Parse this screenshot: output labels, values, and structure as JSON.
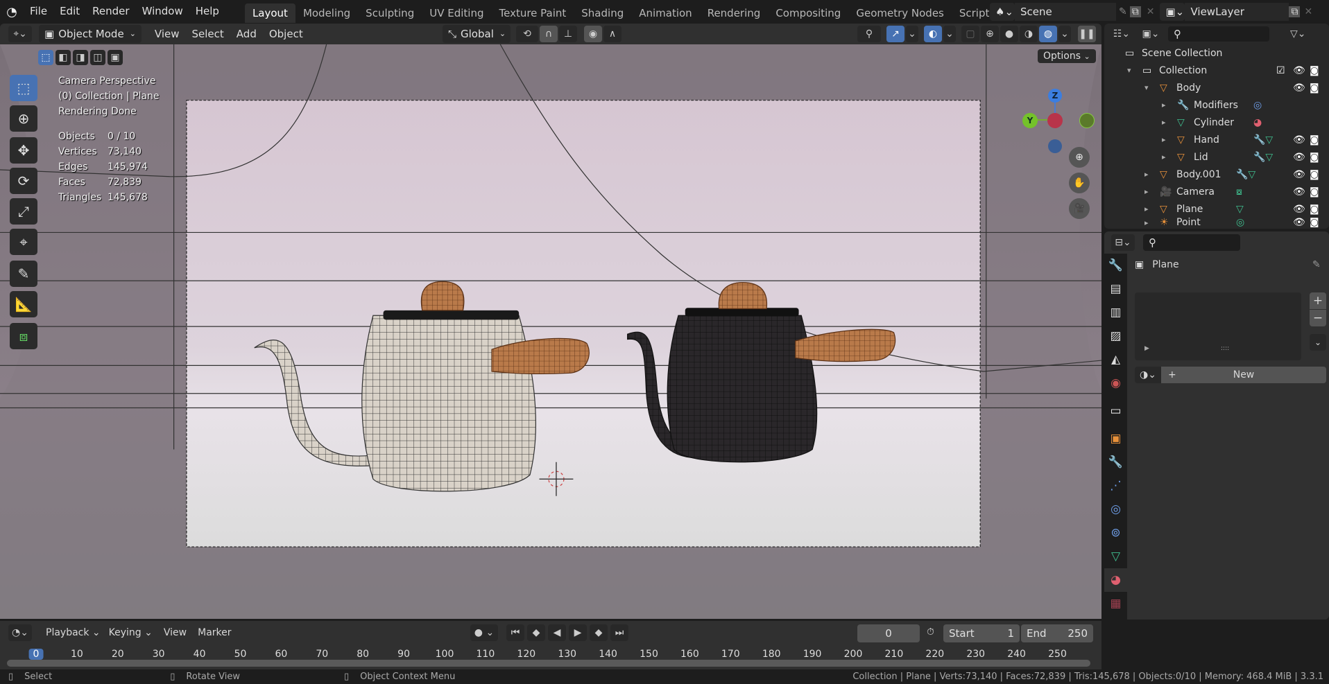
{
  "topbar": {
    "menus": [
      "File",
      "Edit",
      "Render",
      "Window",
      "Help"
    ],
    "workspaces": [
      "Layout",
      "Modeling",
      "Sculpting",
      "UV Editing",
      "Texture Paint",
      "Shading",
      "Animation",
      "Rendering",
      "Compositing",
      "Geometry Nodes",
      "Scripting"
    ],
    "active_workspace": "Layout",
    "add_tab": "+",
    "scene": "Scene",
    "view_layer": "ViewLayer"
  },
  "viewport_header": {
    "mode": "Object Mode",
    "menus": [
      "View",
      "Select",
      "Add",
      "Object"
    ],
    "orientation": "Global",
    "options": "Options"
  },
  "overlay": {
    "line1": "Camera Perspective",
    "line2": "(0) Collection | Plane",
    "line3": "Rendering Done",
    "stats": [
      {
        "label": "Objects",
        "value": "0 / 10"
      },
      {
        "label": "Vertices",
        "value": "73,140"
      },
      {
        "label": "Edges",
        "value": "145,974"
      },
      {
        "label": "Faces",
        "value": "72,839"
      },
      {
        "label": "Triangles",
        "value": "145,678"
      }
    ]
  },
  "gizmo": {
    "z": "Z",
    "y": "Y"
  },
  "outliner": {
    "root": "Scene Collection",
    "items": [
      {
        "label": "Collection",
        "icon": "collection-icon"
      },
      {
        "label": "Body",
        "icon": "mesh-object-icon"
      },
      {
        "label": "Modifiers",
        "icon": "wrench-icon"
      },
      {
        "label": "Cylinder",
        "icon": "mesh-data-icon"
      },
      {
        "label": "Hand",
        "icon": "mesh-object-icon"
      },
      {
        "label": "Lid",
        "icon": "mesh-object-icon"
      },
      {
        "label": "Body.001",
        "icon": "mesh-object-icon"
      },
      {
        "label": "Camera",
        "icon": "camera-icon"
      },
      {
        "label": "Plane",
        "icon": "mesh-object-icon"
      },
      {
        "label": "Point",
        "icon": "light-icon"
      }
    ]
  },
  "properties": {
    "object": "Plane",
    "new_label": "New",
    "add": "+",
    "remove": "−"
  },
  "timeline": {
    "menus": [
      "Playback",
      "Keying",
      "View",
      "Marker"
    ],
    "current_frame": "0",
    "start_label": "Start",
    "start": "1",
    "end_label": "End",
    "end": "250",
    "ticks": [
      "0",
      "10",
      "20",
      "30",
      "40",
      "50",
      "60",
      "70",
      "80",
      "90",
      "100",
      "110",
      "120",
      "130",
      "140",
      "150",
      "160",
      "170",
      "180",
      "190",
      "200",
      "210",
      "220",
      "230",
      "240",
      "250"
    ]
  },
  "status": {
    "select": "Select",
    "rotate": "Rotate View",
    "context": "Object Context Menu",
    "info": "Collection | Plane | Verts:73,140 | Faces:72,839 | Tris:145,678 | Objects:0/10 | Memory: 468.4 MiB | 3.3.1"
  },
  "colors": {
    "accent": "#4772b3",
    "object_orange": "#e8913a",
    "mesh_green": "#3fbf8f",
    "modifier_blue": "#6f9ee8"
  }
}
